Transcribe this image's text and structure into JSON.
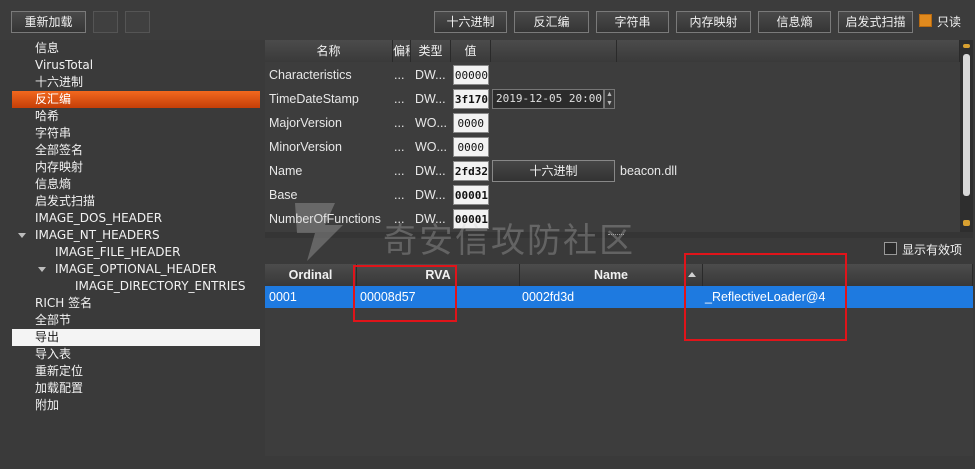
{
  "toolbar": {
    "reload_label": "重新加载",
    "buttons": [
      "十六进制",
      "反汇编",
      "字符串",
      "内存映射",
      "信息熵",
      "启发式扫描"
    ],
    "readonly_label": "只读",
    "readonly_checked": true,
    "accent_color": "#e08a1e"
  },
  "tree": {
    "items": [
      {
        "label": "信息"
      },
      {
        "label": "VirusTotal"
      },
      {
        "label": "十六进制"
      },
      {
        "label": "反汇编",
        "state": "highlighted"
      },
      {
        "label": "哈希"
      },
      {
        "label": "字符串"
      },
      {
        "label": "全部签名"
      },
      {
        "label": "内存映射"
      },
      {
        "label": "信息熵"
      },
      {
        "label": "启发式扫描"
      },
      {
        "label": "IMAGE_DOS_HEADER"
      },
      {
        "label": "IMAGE_NT_HEADERS",
        "expanded": true
      },
      {
        "label": "IMAGE_FILE_HEADER"
      },
      {
        "label": "IMAGE_OPTIONAL_HEADER",
        "expanded": true
      },
      {
        "label": "IMAGE_DIRECTORY_ENTRIES"
      },
      {
        "label": "RICH 签名"
      },
      {
        "label": "全部节"
      },
      {
        "label": "导出",
        "state": "selected"
      },
      {
        "label": "导入表"
      },
      {
        "label": "重新定位"
      },
      {
        "label": "加载配置"
      },
      {
        "label": "附加"
      }
    ]
  },
  "fields": {
    "headers": [
      "名称",
      "偏移",
      "类型",
      "值"
    ],
    "rows": [
      {
        "name": "Characteristics",
        "offset": "...",
        "type": "DW...",
        "value": "00000"
      },
      {
        "name": "TimeDateStamp",
        "offset": "...",
        "type": "DW...",
        "value": "3f170",
        "extra": "2019-12-05 20:00:"
      },
      {
        "name": "MajorVersion",
        "offset": "...",
        "type": "WO...",
        "value": "0000"
      },
      {
        "name": "MinorVersion",
        "offset": "...",
        "type": "WO...",
        "value": "0000"
      },
      {
        "name": "Name",
        "offset": "...",
        "type": "DW...",
        "value": "2fd32",
        "button": "十六进制",
        "extra": "beacon.dll"
      },
      {
        "name": "Base",
        "offset": "...",
        "type": "DW...",
        "value": "00001"
      },
      {
        "name": "NumberOfFunctions",
        "offset": "...",
        "type": "DW...",
        "value": "00001"
      }
    ]
  },
  "watermark": {
    "text": "奇安信攻防社区"
  },
  "show_valid": {
    "label": "显示有效项",
    "checked": false
  },
  "exports": {
    "headers": [
      "Ordinal",
      "RVA",
      "Name",
      ""
    ],
    "rows": [
      {
        "ordinal": "0001",
        "rva": "00008d57",
        "name_rva": "0002fd3d",
        "function": "_ReflectiveLoader@4"
      }
    ],
    "highlight_color": "#e0141a",
    "selection_color": "#1e7ae0"
  }
}
